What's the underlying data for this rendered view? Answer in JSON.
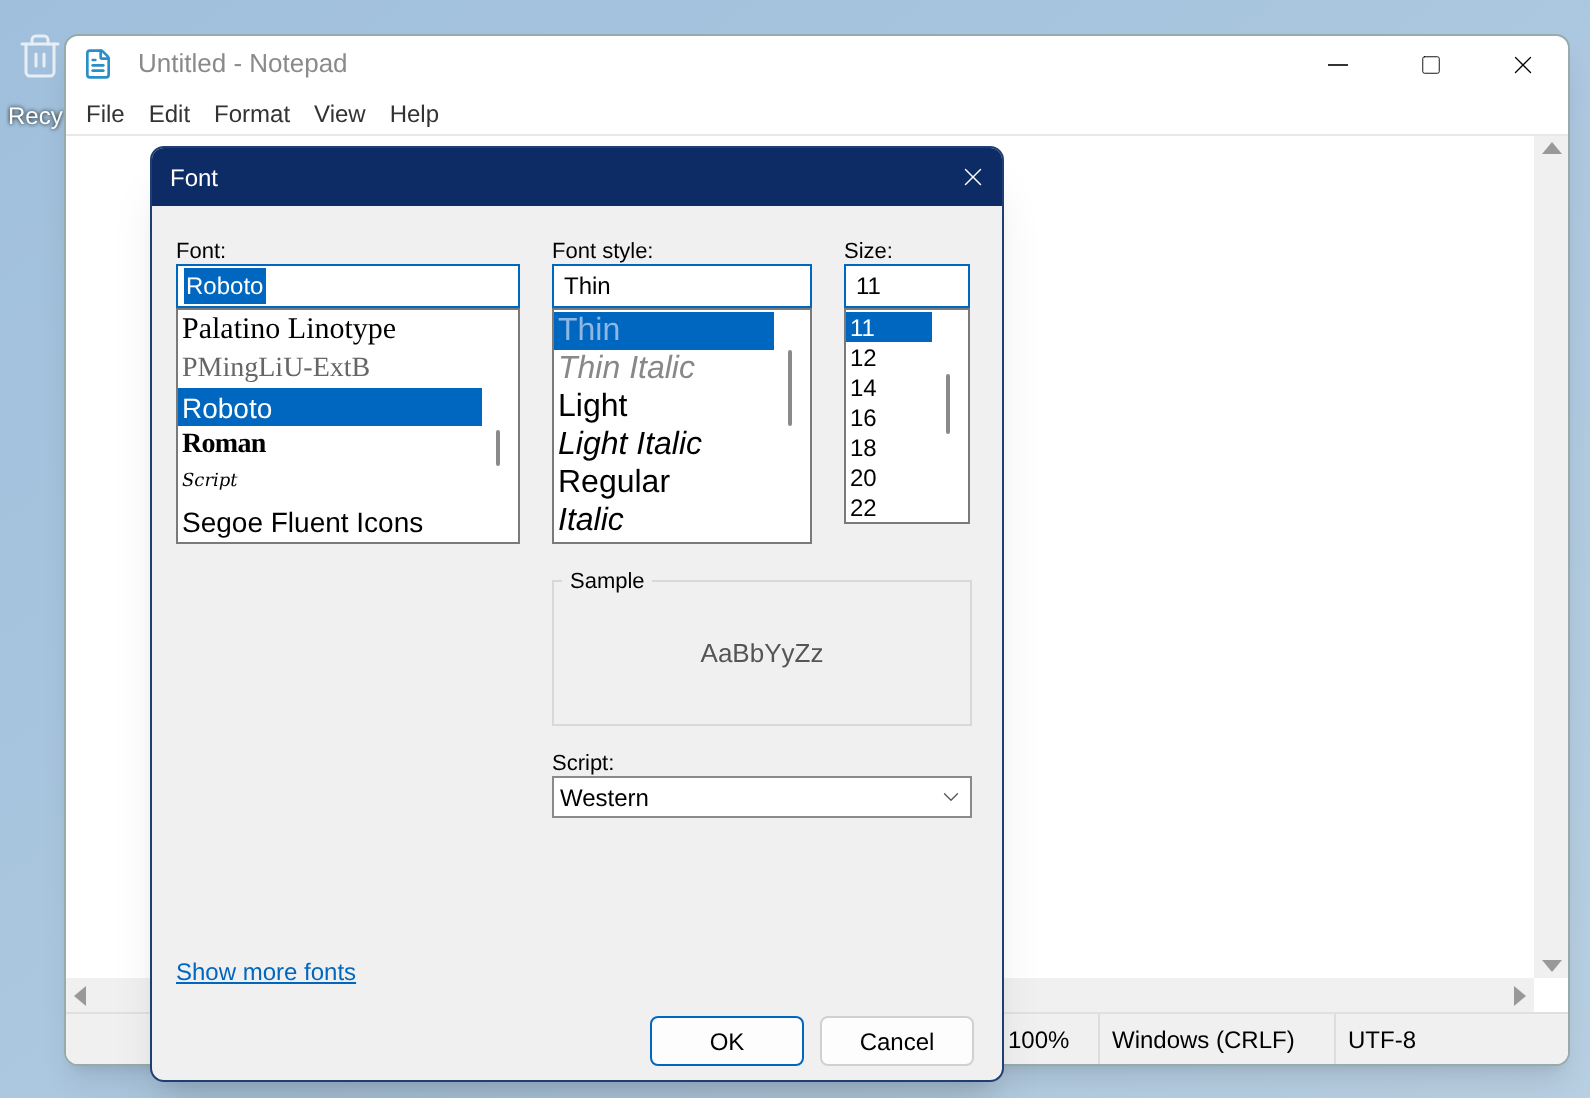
{
  "desktop": {
    "icon_label": "Recy"
  },
  "window": {
    "title": "Untitled - Notepad"
  },
  "menu": [
    "File",
    "Edit",
    "Format",
    "View",
    "Help"
  ],
  "status_bar": [
    "100%",
    "Windows (CRLF)",
    "UTF-8"
  ],
  "dialog": {
    "title": "Font",
    "font": {
      "label": "Font:",
      "value": "Roboto",
      "items": [
        {
          "label": "Palatino Linotype",
          "kind": "serif",
          "selected": false
        },
        {
          "label": "PMingLiU-ExtB",
          "kind": "serif-gray",
          "selected": false
        },
        {
          "label": "Roboto",
          "kind": "sans",
          "selected": true
        },
        {
          "label": "Roman",
          "kind": "mono",
          "selected": false
        },
        {
          "label": "Script",
          "kind": "script",
          "selected": false
        },
        {
          "label": "Segoe Fluent Icons",
          "kind": "sans",
          "selected": false
        }
      ]
    },
    "style": {
      "label": "Font style:",
      "value": "Thin",
      "items": [
        {
          "label": "Thin",
          "kind": "thin",
          "selected": true
        },
        {
          "label": "Thin Italic",
          "kind": "thin-italic",
          "selected": false
        },
        {
          "label": "Light",
          "kind": "light",
          "selected": false
        },
        {
          "label": "Light Italic",
          "kind": "light-italic",
          "selected": false
        },
        {
          "label": "Regular",
          "kind": "regular",
          "selected": false
        },
        {
          "label": "Italic",
          "kind": "italic",
          "selected": false
        }
      ]
    },
    "size": {
      "label": "Size:",
      "value": "11",
      "items": [
        {
          "label": "11",
          "selected": true
        },
        {
          "label": "12",
          "selected": false
        },
        {
          "label": "14",
          "selected": false
        },
        {
          "label": "16",
          "selected": false
        },
        {
          "label": "18",
          "selected": false
        },
        {
          "label": "20",
          "selected": false
        },
        {
          "label": "22",
          "selected": false
        }
      ]
    },
    "sample": {
      "label": "Sample",
      "text": "AaBbYyZz"
    },
    "script": {
      "label": "Script:",
      "value": "Western"
    },
    "link": "Show more fonts",
    "buttons": [
      "OK",
      "Cancel"
    ]
  }
}
